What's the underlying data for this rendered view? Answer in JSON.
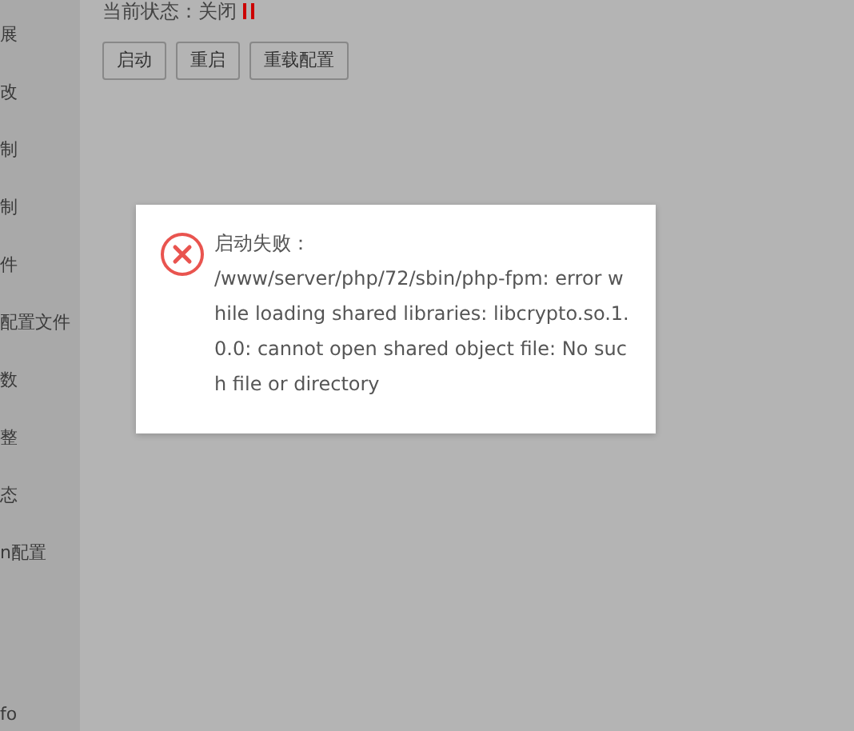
{
  "sidebar": {
    "items": [
      {
        "label": "展"
      },
      {
        "label": "改"
      },
      {
        "label": "制"
      },
      {
        "label": "制"
      },
      {
        "label": "件"
      },
      {
        "label": "配置文件"
      },
      {
        "label": "数"
      },
      {
        "label": "整"
      },
      {
        "label": "态"
      },
      {
        "label": "n配置"
      },
      {
        "label": "fo"
      }
    ]
  },
  "status": {
    "label": "当前状态：",
    "value": "关闭",
    "running": false
  },
  "buttons": [
    "启动",
    "重启",
    "重载配置"
  ],
  "dialog": {
    "kind": "error",
    "title": "启动失败：",
    "message": "/www/server/php/72/sbin/php-fpm: error while loading shared libraries: libcrypto.so.1.0.0: cannot open shared object file: No such file or directory"
  }
}
